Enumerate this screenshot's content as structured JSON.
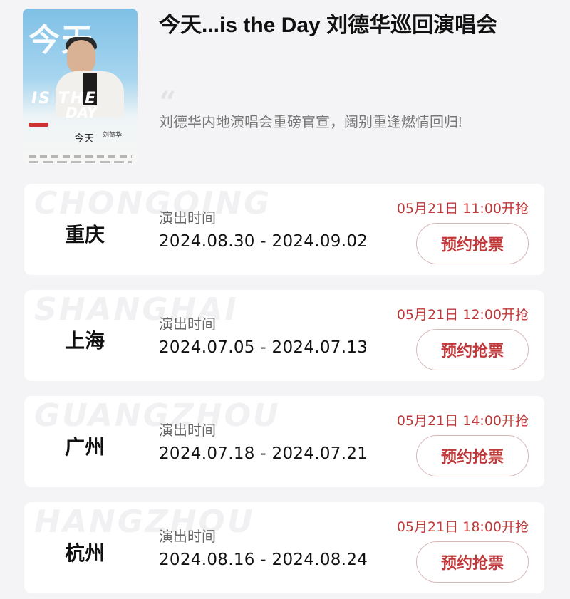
{
  "event": {
    "title": "今天...is the Day 刘德华巡回演唱会",
    "subtitle": "刘德华内地演唱会重磅官宣，阔别重逢燃情回归!",
    "quote_mark": "“",
    "poster": {
      "big_title": "今天",
      "is_the": "IS THE",
      "day": "DAY",
      "mini_title": "今天",
      "mini_name": "刘德华"
    }
  },
  "shows": [
    {
      "watermark": "CHONGQING",
      "city": "重庆",
      "time_label": "演出时间",
      "date_range": "2024.08.30 - 2024.09.02",
      "sale_time": "05月21日 11:00开抢",
      "button_label": "预约抢票"
    },
    {
      "watermark": "SHANGHAI",
      "city": "上海",
      "time_label": "演出时间",
      "date_range": "2024.07.05 - 2024.07.13",
      "sale_time": "05月21日 12:00开抢",
      "button_label": "预约抢票"
    },
    {
      "watermark": "GUANGZHOU",
      "city": "广州",
      "time_label": "演出时间",
      "date_range": "2024.07.18 - 2024.07.21",
      "sale_time": "05月21日 14:00开抢",
      "button_label": "预约抢票"
    },
    {
      "watermark": "HANGZHOU",
      "city": "杭州",
      "time_label": "演出时间",
      "date_range": "2024.08.16 - 2024.08.24",
      "sale_time": "05月21日 18:00开抢",
      "button_label": "预约抢票"
    }
  ],
  "colors": {
    "accent": "#c0393a",
    "button_border": "#d8b7b7",
    "background": "#f4f4f6"
  }
}
